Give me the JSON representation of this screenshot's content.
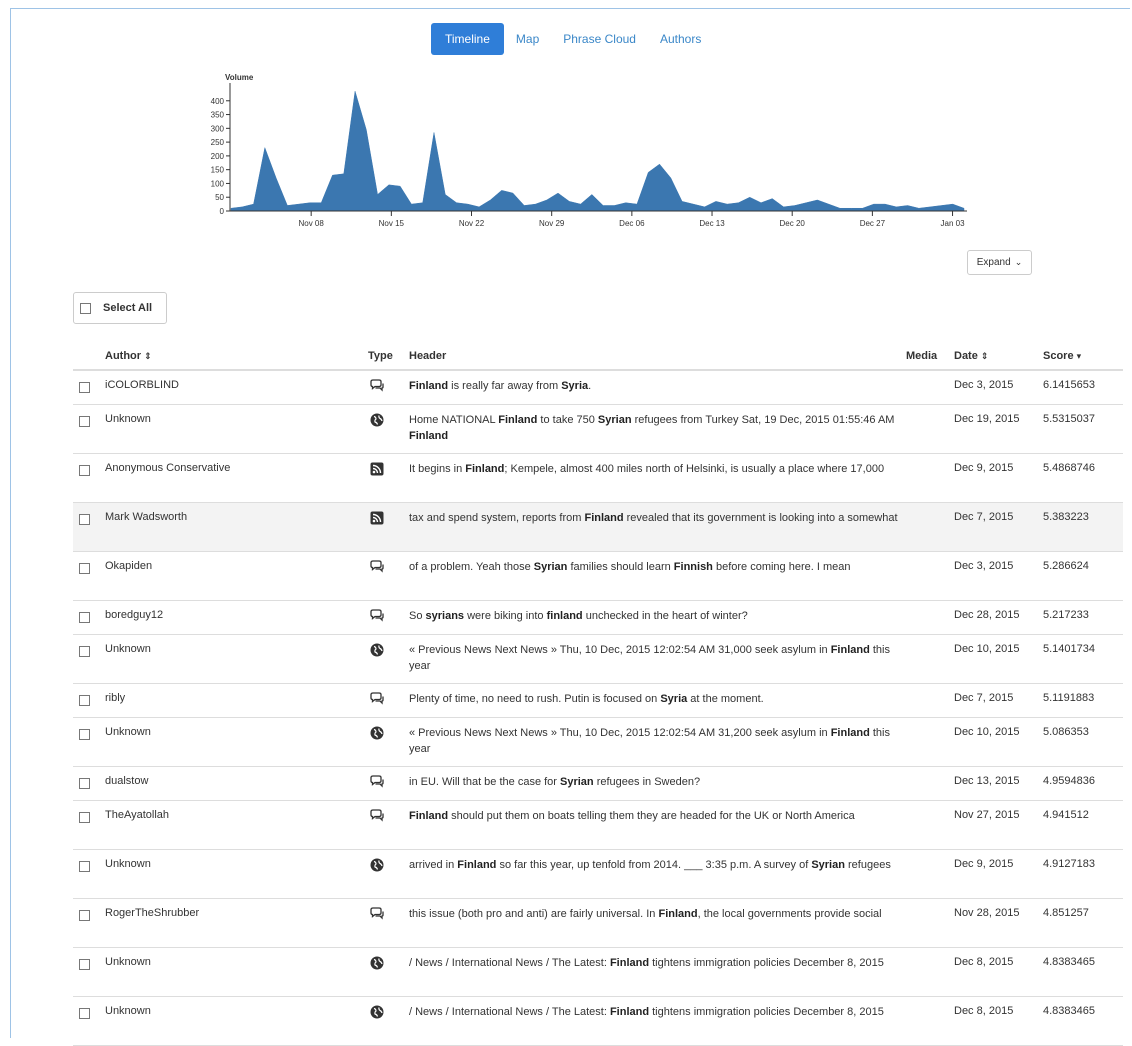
{
  "tabs": [
    "Timeline",
    "Map",
    "Phrase Cloud",
    "Authors"
  ],
  "active_tab": "Timeline",
  "chart_data": {
    "type": "area",
    "title": "Volume",
    "x_ticks": [
      "Nov 08",
      "Nov 15",
      "Nov 22",
      "Nov 29",
      "Dec 06",
      "Dec 13",
      "Dec 20",
      "Dec 27",
      "Jan 03"
    ],
    "y_ticks": [
      0,
      50,
      100,
      150,
      200,
      250,
      300,
      350,
      400
    ],
    "ylim": [
      0,
      450
    ],
    "x_start": "2015-11-01",
    "values": [
      10,
      15,
      25,
      230,
      120,
      20,
      25,
      30,
      30,
      130,
      135,
      435,
      295,
      60,
      95,
      90,
      25,
      30,
      285,
      60,
      30,
      25,
      15,
      40,
      75,
      65,
      20,
      25,
      40,
      65,
      35,
      25,
      60,
      20,
      20,
      30,
      25,
      140,
      170,
      120,
      35,
      25,
      15,
      35,
      25,
      30,
      50,
      30,
      45,
      15,
      20,
      30,
      40,
      25,
      10,
      10,
      10,
      25,
      25,
      15,
      20,
      10,
      15,
      20,
      25,
      10
    ],
    "color": "#3b77b0"
  },
  "expand_label": "Expand",
  "select_all_label": "Select All",
  "columns": {
    "author": "Author",
    "type": "Type",
    "header": "Header",
    "media": "Media",
    "date": "Date",
    "score": "Score"
  },
  "rows": [
    {
      "author": "iCOLORBLIND",
      "type": "comment",
      "header": [
        {
          "t": "Finland",
          "b": true
        },
        {
          "t": " is really far away from "
        },
        {
          "t": "Syria",
          "b": true
        },
        {
          "t": "."
        }
      ],
      "date": "Dec 3, 2015",
      "score": "6.1415653"
    },
    {
      "author": "Unknown",
      "type": "globe",
      "header": [
        {
          "t": "Home NATIONAL "
        },
        {
          "t": "Finland",
          "b": true
        },
        {
          "t": " to take 750 "
        },
        {
          "t": "Syrian",
          "b": true
        },
        {
          "t": " refugees from Turkey Sat, 19 Dec, 2015 01:55:46 AM "
        },
        {
          "t": "Finland",
          "b": true
        }
      ],
      "date": "Dec 19, 2015",
      "score": "5.5315037"
    },
    {
      "author": "Anonymous Conservative",
      "type": "rss",
      "header": [
        {
          "t": "It begins in "
        },
        {
          "t": "Finland",
          "b": true
        },
        {
          "t": "; Kempele, almost 400 miles north of Helsinki, is usually a place where 17,000"
        }
      ],
      "date": "Dec 9, 2015",
      "score": "5.4868746"
    },
    {
      "author": "Mark Wadsworth",
      "type": "rss",
      "highlight": true,
      "header": [
        {
          "t": "tax and spend system, reports from "
        },
        {
          "t": "Finland",
          "b": true
        },
        {
          "t": " revealed that its government is looking into a somewhat"
        }
      ],
      "date": "Dec 7, 2015",
      "score": "5.383223"
    },
    {
      "author": "Okapiden",
      "type": "comment",
      "header": [
        {
          "t": "of a problem. Yeah those "
        },
        {
          "t": "Syrian",
          "b": true
        },
        {
          "t": " families should learn "
        },
        {
          "t": "Finnish",
          "b": true
        },
        {
          "t": " before coming here. I mean"
        }
      ],
      "date": "Dec 3, 2015",
      "score": "5.286624"
    },
    {
      "author": "boredguy12",
      "type": "comment",
      "header": [
        {
          "t": "So "
        },
        {
          "t": "syrians",
          "b": true
        },
        {
          "t": " were biking into "
        },
        {
          "t": "finland",
          "b": true
        },
        {
          "t": " unchecked in the heart of winter?"
        }
      ],
      "date": "Dec 28, 2015",
      "score": "5.217233"
    },
    {
      "author": "Unknown",
      "type": "globe",
      "header": [
        {
          "t": "« Previous News Next News » Thu, 10 Dec, 2015 12:02:54 AM 31,000 seek asylum in "
        },
        {
          "t": "Finland",
          "b": true
        },
        {
          "t": " this year"
        }
      ],
      "date": "Dec 10, 2015",
      "score": "5.1401734"
    },
    {
      "author": "ribly",
      "type": "comment",
      "header": [
        {
          "t": "Plenty of time, no need to rush. Putin is focused on "
        },
        {
          "t": "Syria",
          "b": true
        },
        {
          "t": " at the moment."
        }
      ],
      "date": "Dec 7, 2015",
      "score": "5.1191883"
    },
    {
      "author": "Unknown",
      "type": "globe",
      "header": [
        {
          "t": "« Previous News Next News » Thu, 10 Dec, 2015 12:02:54 AM 31,200 seek asylum in "
        },
        {
          "t": "Finland",
          "b": true
        },
        {
          "t": " this year"
        }
      ],
      "date": "Dec 10, 2015",
      "score": "5.086353"
    },
    {
      "author": "dualstow",
      "type": "comment",
      "header": [
        {
          "t": "in EU. Will that be the case for "
        },
        {
          "t": "Syrian",
          "b": true
        },
        {
          "t": " refugees in Sweden?"
        }
      ],
      "date": "Dec 13, 2015",
      "score": "4.9594836"
    },
    {
      "author": "TheAyatollah",
      "type": "comment",
      "header": [
        {
          "t": "Finland",
          "b": true
        },
        {
          "t": " should put them on boats telling them they are headed for the UK or North America"
        }
      ],
      "date": "Nov 27, 2015",
      "score": "4.941512"
    },
    {
      "author": "Unknown",
      "type": "globe",
      "header": [
        {
          "t": "arrived in "
        },
        {
          "t": "Finland",
          "b": true
        },
        {
          "t": " so far this year, up tenfold from 2014. ___ 3:35 p.m. A survey of "
        },
        {
          "t": "Syrian",
          "b": true
        },
        {
          "t": " refugees"
        }
      ],
      "date": "Dec 9, 2015",
      "score": "4.9127183"
    },
    {
      "author": "RogerTheShrubber",
      "type": "comment",
      "header": [
        {
          "t": "this issue (both pro and anti) are fairly universal. In "
        },
        {
          "t": "Finland",
          "b": true
        },
        {
          "t": ", the local governments provide social"
        }
      ],
      "date": "Nov 28, 2015",
      "score": "4.851257"
    },
    {
      "author": "Unknown",
      "type": "globe",
      "header": [
        {
          "t": "/ News / International News / The Latest: "
        },
        {
          "t": "Finland",
          "b": true
        },
        {
          "t": " tightens immigration policies December 8, 2015"
        }
      ],
      "date": "Dec 8, 2015",
      "score": "4.8383465"
    },
    {
      "author": "Unknown",
      "type": "globe",
      "header": [
        {
          "t": "/ News / International News / The Latest: "
        },
        {
          "t": "Finland",
          "b": true
        },
        {
          "t": " tightens immigration policies December 8, 2015"
        }
      ],
      "date": "Dec 8, 2015",
      "score": "4.8383465"
    }
  ]
}
